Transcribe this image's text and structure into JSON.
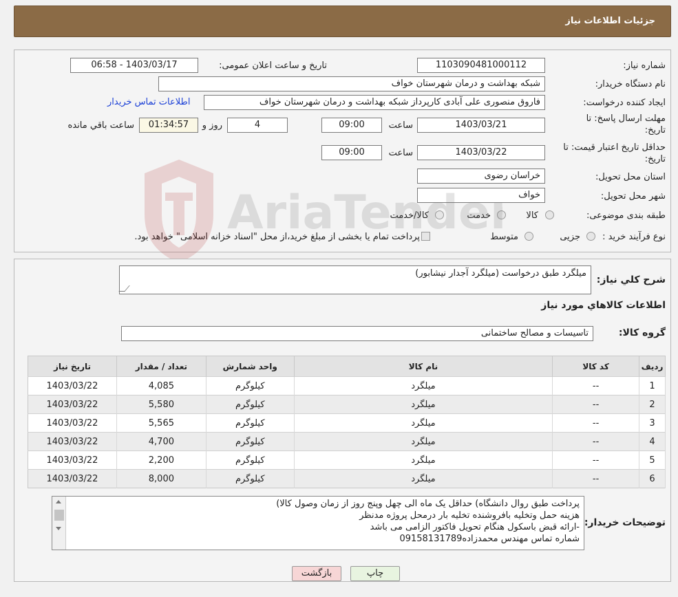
{
  "header": {
    "title": "جزئیات اطلاعات نیاز"
  },
  "form": {
    "need_number_label": "شماره نیاز:",
    "need_number": "1103090481000112",
    "announce_label": "تاریخ و ساعت اعلان عمومی:",
    "announce_value": "1403/03/17 - 06:58",
    "buyer_label": "نام دستگاه خریدار:",
    "buyer": "شبکه بهداشت و درمان شهرستان خواف",
    "creator_label": "ایجاد کننده درخواست:",
    "creator": "فاروق منصوری علی آبادی کارپرداز شبکه بهداشت و درمان شهرستان خواف",
    "contact_link": "اطلاعات تماس خریدار",
    "deadline_label_1": "مهلت ارسال پاسخ: تا",
    "deadline_label_2": "تاریخ:",
    "deadline_date": "1403/03/21",
    "time_label": "ساعت",
    "deadline_time": "09:00",
    "days_value": "4",
    "days_label": "روز و",
    "remaining_time": "01:34:57",
    "remaining_label": "ساعت باقي مانده",
    "validity_label_1": "حداقل تاریخ اعتبار قیمت: تا",
    "validity_label_2": "تاریخ:",
    "validity_date": "1403/03/22",
    "validity_time": "09:00",
    "province_label": "استان محل تحویل:",
    "province": "خراسان رضوی",
    "city_label": "شهر محل تحویل:",
    "city": "خواف",
    "category_label": "طبقه بندی موضوعی:",
    "category_options": [
      "کالا",
      "خدمت",
      "کالا/خدمت"
    ],
    "process_label": "نوع فرآیند خرید :",
    "process_options": [
      "جزیی",
      "متوسط"
    ],
    "process_note": "پرداخت تمام یا بخشی از مبلغ خرید،از محل \"اسناد خزانه اسلامی\" خواهد بود."
  },
  "details": {
    "summary_label": "شرح کلي نیاز:",
    "summary": "میلگرد طبق درخواست (میلگرد آجدار نیشابور)",
    "goods_title": "اطلاعات کالاهاي مورد نیاز",
    "group_label": "گروه کالا:",
    "group": "تاسیسات و مصالح ساختمانی",
    "columns": [
      "ردیف",
      "کد کالا",
      "نام کالا",
      "واحد شمارش",
      "تعداد / مقدار",
      "تاریخ نیاز"
    ],
    "rows": [
      [
        "1",
        "--",
        "میلگرد",
        "کیلوگرم",
        "4,085",
        "1403/03/22"
      ],
      [
        "2",
        "--",
        "میلگرد",
        "کیلوگرم",
        "5,580",
        "1403/03/22"
      ],
      [
        "3",
        "--",
        "میلگرد",
        "کیلوگرم",
        "5,565",
        "1403/03/22"
      ],
      [
        "4",
        "--",
        "میلگرد",
        "کیلوگرم",
        "4,700",
        "1403/03/22"
      ],
      [
        "5",
        "--",
        "میلگرد",
        "کیلوگرم",
        "2,200",
        "1403/03/22"
      ],
      [
        "6",
        "--",
        "میلگرد",
        "کیلوگرم",
        "8,000",
        "1403/03/22"
      ]
    ],
    "buyer_notes_label": "توضیحات خریدار:",
    "buyer_notes": [
      "پرداخت طبق روال دانشگاه) حداقل یک ماه الی چهل وپنج روز از زمان وصول کالا)",
      "هزینه حمل وتخلیه بافروشنده تخلیه بار درمحل پروژه مدنظر",
      "-ارائه قبض باسکول هنگام تحویل فاکتور الزامی می باشد",
      "شماره تماس مهندس محمدزاده09158131789"
    ]
  },
  "buttons": {
    "print": "چاپ",
    "back": "بازگشت"
  },
  "watermark": {
    "text": "AriaTender.neT"
  },
  "colors": {
    "header": "#8b6b46",
    "back_button": "#f7d6d6",
    "print_button": "#e8f4e0",
    "link": "#1a3fd6"
  }
}
